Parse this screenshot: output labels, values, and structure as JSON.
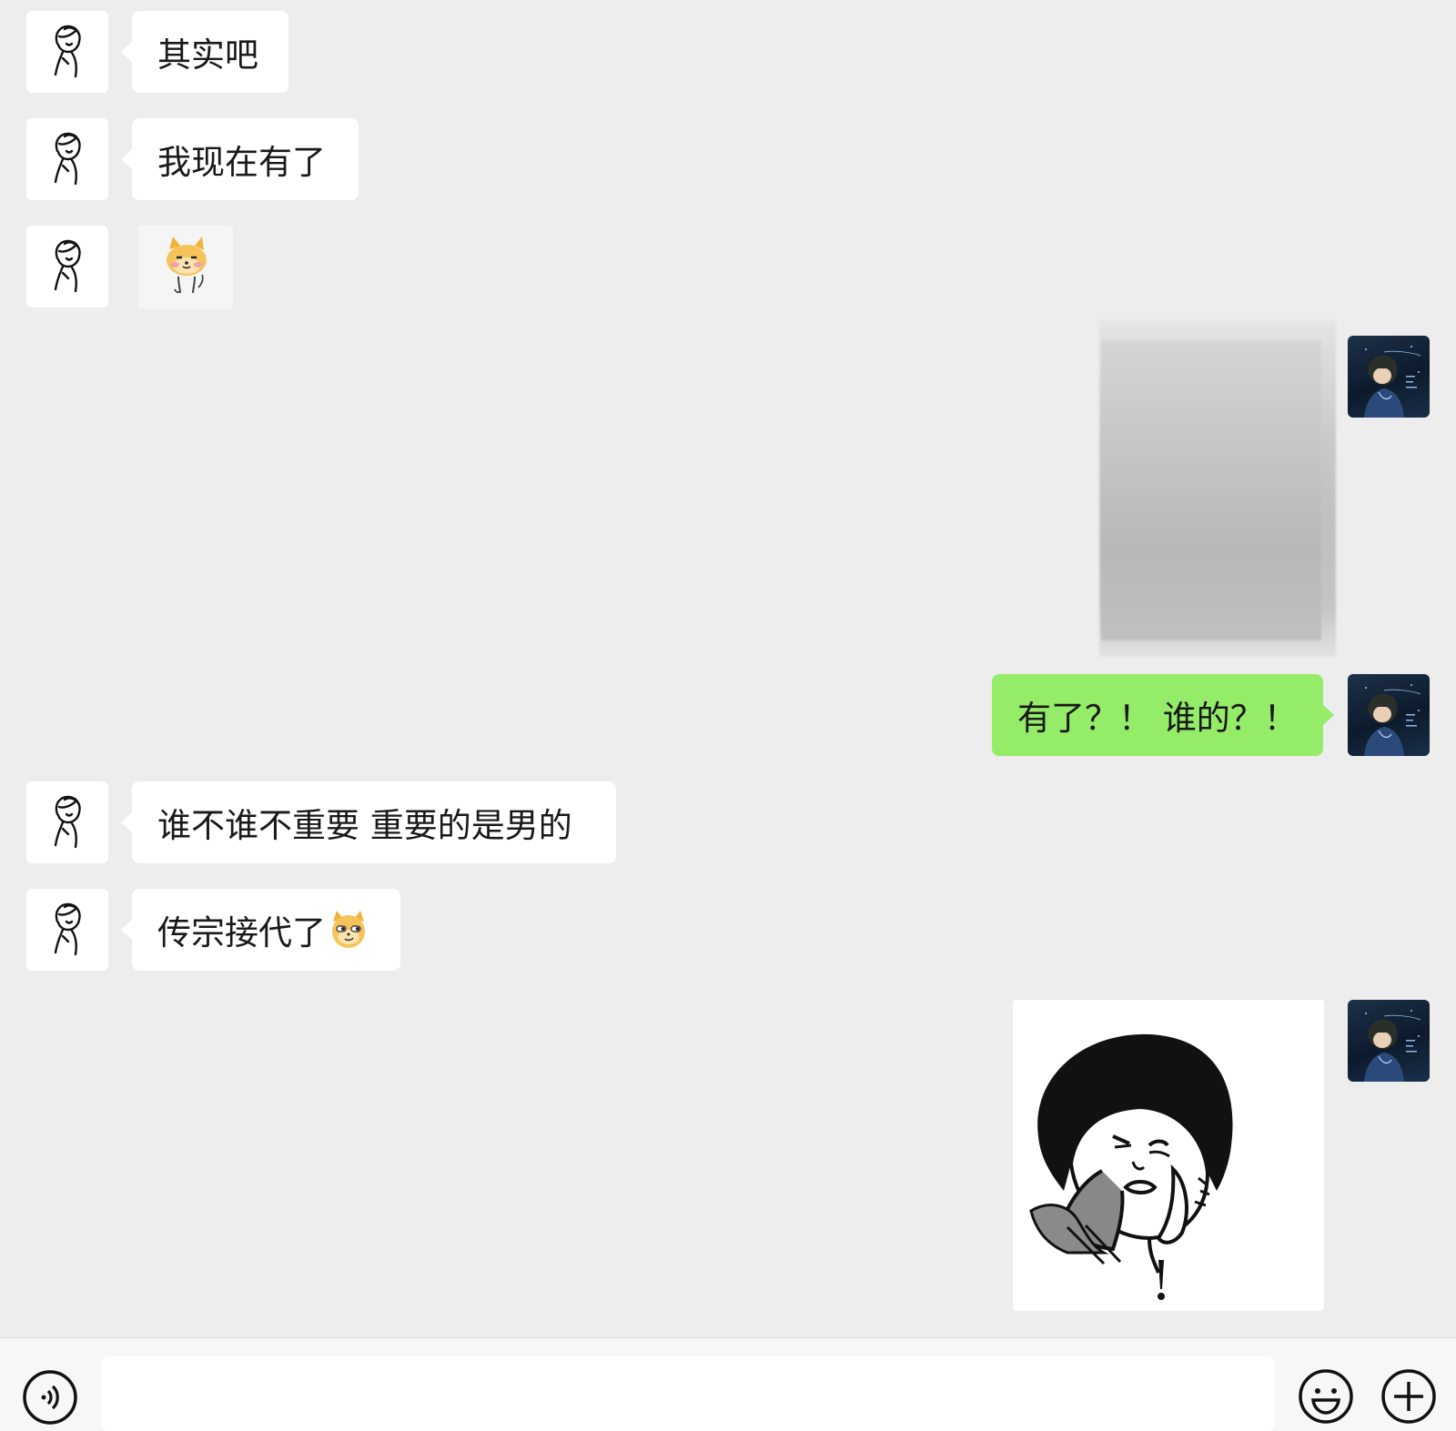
{
  "messages": [
    {
      "from": "friend",
      "type": "text",
      "text": "其实吧"
    },
    {
      "from": "friend",
      "type": "text",
      "text": "我现在有了"
    },
    {
      "from": "friend",
      "type": "sticker",
      "sticker": "shiba-dog-sticker"
    },
    {
      "from": "me",
      "type": "image",
      "note": ""
    },
    {
      "from": "me",
      "type": "text",
      "text": "有了？！ 谁的？！"
    },
    {
      "from": "friend",
      "type": "text",
      "text": "谁不谁不重要 重要的是男的"
    },
    {
      "from": "friend",
      "type": "text",
      "text": "传宗接代了"
    },
    {
      "from": "me",
      "type": "sticker",
      "sticker": "mushroom-head-surprised-sticker",
      "caption": "!"
    }
  ],
  "icons": {
    "voice": "voice-icon",
    "emoji": "emoji-icon",
    "plus": "plus-icon",
    "inline_emoji": "shiba-smirk-emoji-icon"
  },
  "colors": {
    "background": "#ededed",
    "incoming_bubble": "#ffffff",
    "outgoing_bubble": "#95ec69",
    "text": "#191919"
  },
  "composer": {
    "value": "",
    "placeholder": ""
  }
}
